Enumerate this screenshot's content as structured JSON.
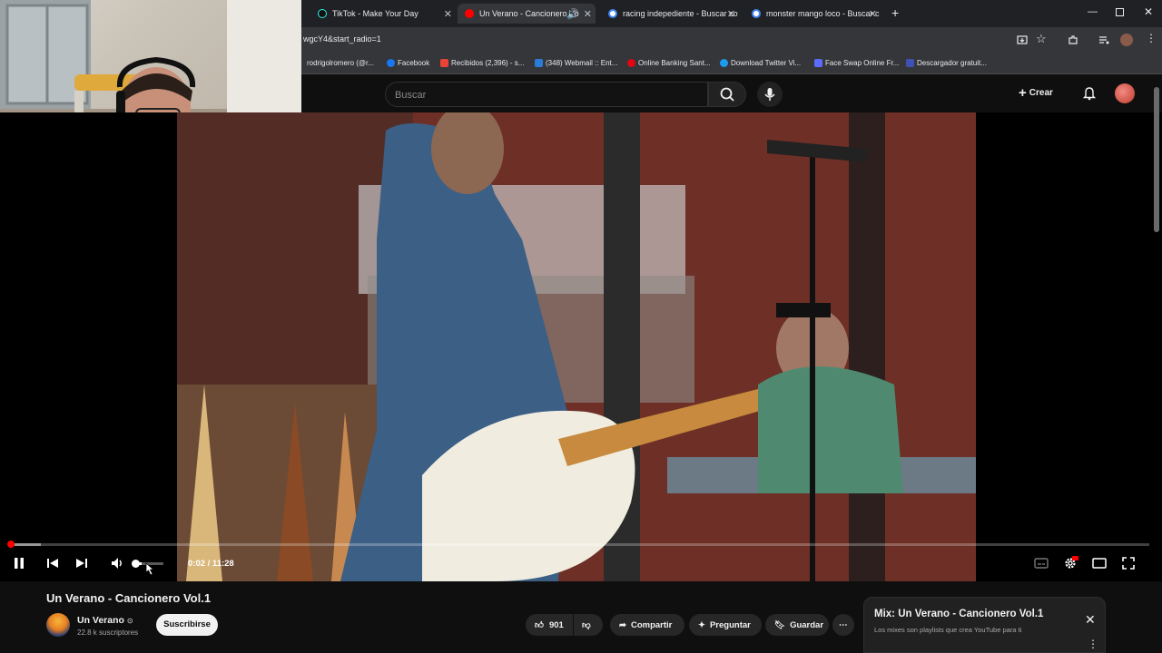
{
  "browser": {
    "tabs": [
      {
        "label": "TikTok - Make Your Day",
        "active": false
      },
      {
        "label": "Un Verano - Cancionero Vo",
        "active": true
      },
      {
        "label": "racing indepediente - Buscar co",
        "active": false
      },
      {
        "label": "monster mango loco - Buscar c",
        "active": false
      }
    ],
    "url": "wgcY4&start_radio=1",
    "bookmarks": [
      "rodrigolromero (@r...",
      "Facebook",
      "Recibidos (2,396) - s...",
      "(348) Webmail :: Ent...",
      "Online Banking Sant...",
      "Download Twitter Vi...",
      "Face Swap Online Fr...",
      "Descargador gratuit..."
    ]
  },
  "youtube": {
    "search_placeholder": "Buscar",
    "create_label": "Crear"
  },
  "player": {
    "time": "0:02 / 11:28",
    "progress_fraction": 0.003,
    "buffer_fraction": 0.026,
    "volume_fraction": 0.3
  },
  "video": {
    "title": "Un Verano - Cancionero Vol.1",
    "channel": "Un Verano",
    "subscribers": "22.8 k suscriptores",
    "subscribe_label": "Suscribirse",
    "likes": "901",
    "share_label": "Compartir",
    "ask_label": "Preguntar",
    "save_label": "Guardar"
  },
  "mix": {
    "title": "Mix: Un Verano - Cancionero Vol.1",
    "subtitle": "Los mixes son playlists que crea YouTube para ti"
  },
  "colors": {
    "accent": "#ff0000",
    "background": "#0f0f0f",
    "pill": "#272727"
  }
}
